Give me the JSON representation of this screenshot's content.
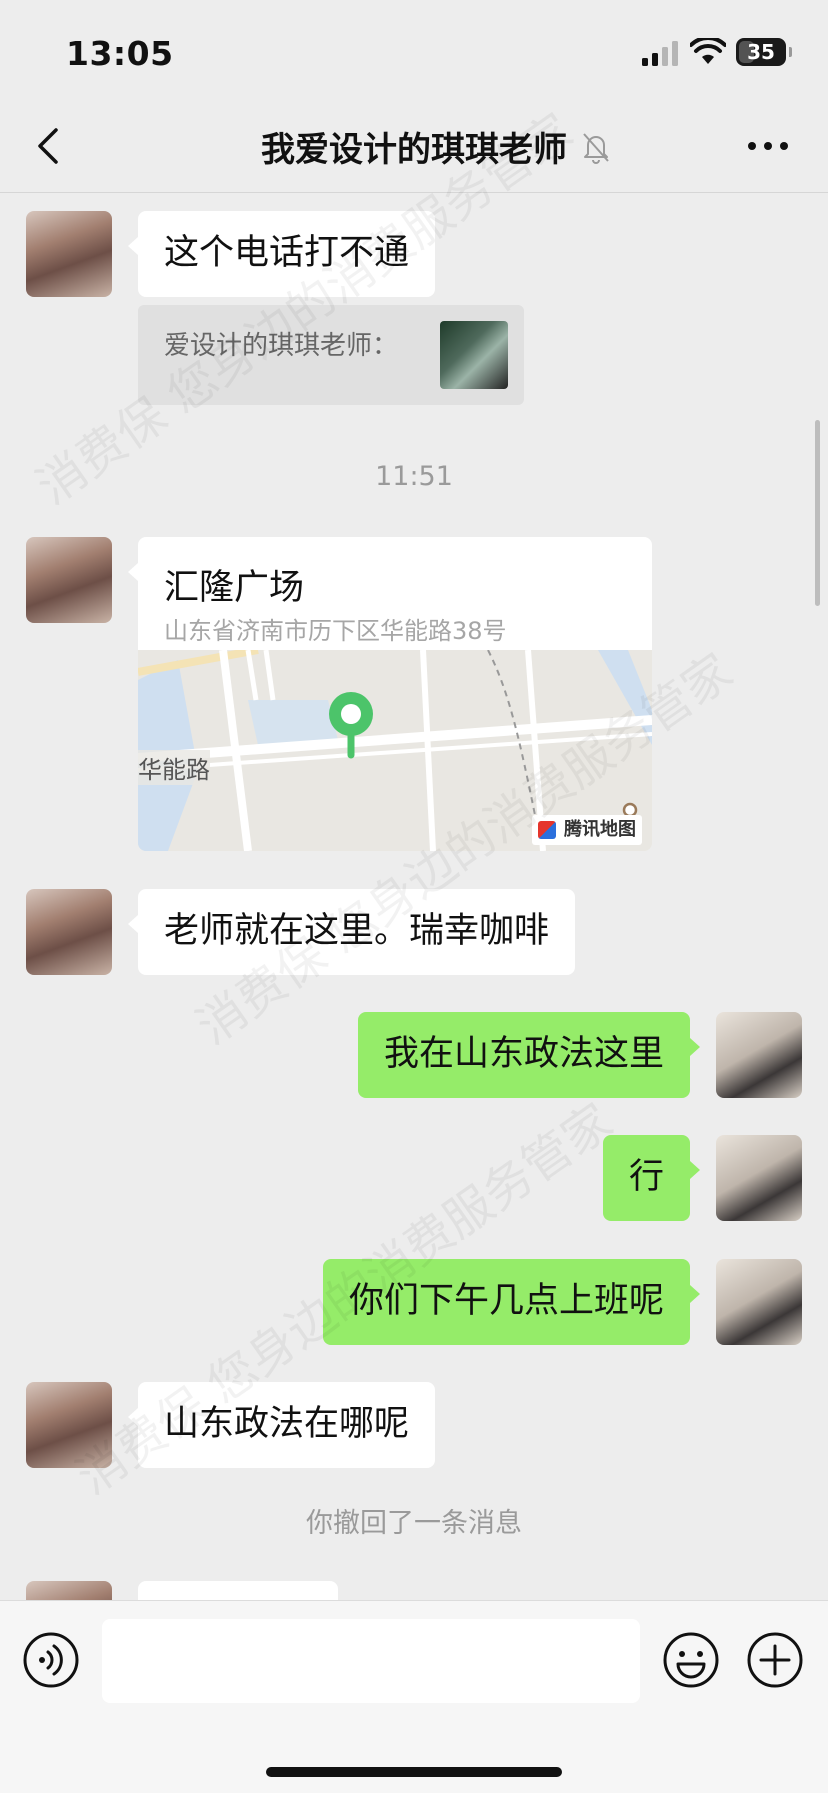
{
  "status": {
    "time": "13:05",
    "battery": "35",
    "battery_level": 0.35
  },
  "nav": {
    "title": "我爱设计的琪琪老师"
  },
  "messages": {
    "m1": "这个电话打不通",
    "quote_sender": "爱设计的琪琪老师：",
    "timestamp": "11:51",
    "location": {
      "name": "汇隆广场",
      "address": "山东省济南市历下区华能路38号",
      "map_road_label": "华能路",
      "map_brand": "腾讯地图"
    },
    "m2": "老师就在这里。瑞幸咖啡",
    "m3": "我在山东政法这里",
    "m4": "行",
    "m5": "你们下午几点上班呢",
    "m6": "山东政法在哪呢",
    "recall_notice": "你撤回了一条消息"
  },
  "input": {
    "placeholder": "",
    "value": ""
  },
  "watermark": {
    "text": "消费保 您身边的消费服务管家"
  },
  "colors": {
    "accent_green": "#95ec69",
    "map_pin": "#4cc46a",
    "background": "#ededed"
  },
  "icons": {
    "back": "chevron-left-icon",
    "mute": "bell-slash-icon",
    "more": "more-dots-icon",
    "voice": "voice-icon",
    "emoji": "smiley-icon",
    "plus": "plus-circle-icon"
  }
}
